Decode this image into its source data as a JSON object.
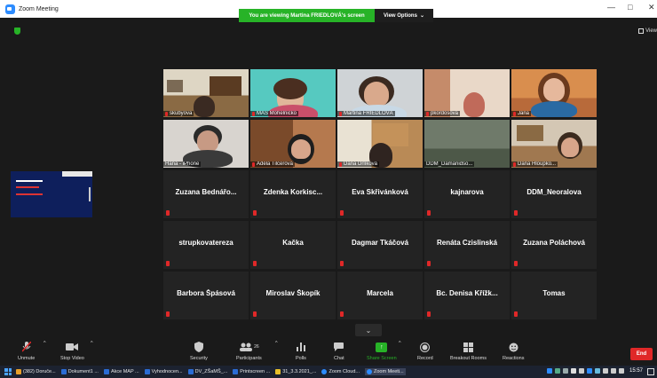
{
  "window": {
    "title": "Zoom Meeting",
    "share_banner": "You are viewing Martina FRIEDLOVÁ's screen",
    "view_options": "View Options",
    "view_options_caret": "⌄",
    "minimize": "—",
    "maximize": "□",
    "close": "✕",
    "view_button": "View"
  },
  "colors": {
    "accent_green": "#27b327",
    "mute_red": "#e02828",
    "end_red": "#e02828",
    "active_speaker": "#b3e23b"
  },
  "video_tiles": [
    {
      "name": "skubyova",
      "muted": true
    },
    {
      "name": "MAS Mohelnicko",
      "muted": true
    },
    {
      "name": "Martina FRIEDLOVÁ",
      "muted": true,
      "active": true
    },
    {
      "name": "pkordosova",
      "muted": true
    },
    {
      "name": "Jana",
      "muted": true
    },
    {
      "name": "Hana - iPhone",
      "muted": false
    },
    {
      "name": "Adéla Tilcerová",
      "muted": true
    },
    {
      "name": "Dana Drlíková",
      "muted": true
    },
    {
      "name": "DDM_Damanidso...",
      "muted": false
    },
    {
      "name": "Dana Hloupko...",
      "muted": true
    }
  ],
  "name_tiles": [
    {
      "name": "Zuzana  Bednářo..."
    },
    {
      "name": "Zdenka  Korkisc..."
    },
    {
      "name": "Eva Skřivánková"
    },
    {
      "name": "kajnarova"
    },
    {
      "name": "DDM_Neoralova"
    },
    {
      "name": "strupkovatereza"
    },
    {
      "name": "Kačka"
    },
    {
      "name": "Dagmar Tkáčová"
    },
    {
      "name": "Renáta Czislinská"
    },
    {
      "name": "Zuzana Poláchová"
    },
    {
      "name": "Barbora Špásová"
    },
    {
      "name": "Miroslav Škopík"
    },
    {
      "name": "Marcela"
    },
    {
      "name": "Bc. Denisa Křížk..."
    },
    {
      "name": "Tomas"
    }
  ],
  "toolbar": {
    "unmute": "Unmute",
    "stop_video": "Stop Video",
    "security": "Security",
    "participants": "Participants",
    "participants_count": "26",
    "polls": "Polls",
    "chat": "Chat",
    "share_screen": "Share Screen",
    "record": "Record",
    "breakout_rooms": "Breakout Rooms",
    "reactions": "Reactions",
    "end": "End",
    "chevron": "⌄",
    "caret": "^"
  },
  "taskbar": {
    "items": [
      {
        "label": "(382) Doruče...",
        "color": "#e8a02a"
      },
      {
        "label": "Dokument1 ...",
        "color": "#2b6cd4"
      },
      {
        "label": "Akce MAP ...",
        "color": "#2b6cd4"
      },
      {
        "label": "Vyhodnocen...",
        "color": "#2b6cd4"
      },
      {
        "label": "DV_ZŠaMŠ_...",
        "color": "#2b6cd4"
      },
      {
        "label": "Printscreen ...",
        "color": "#2b6cd4"
      },
      {
        "label": "31_3.3.2021_...",
        "color": "#e8c02a"
      },
      {
        "label": "Zoom Cloud...",
        "color": "#2d8cff"
      },
      {
        "label": "Zoom Meeti...",
        "color": "#2d8cff"
      }
    ],
    "clock": "15:57"
  }
}
